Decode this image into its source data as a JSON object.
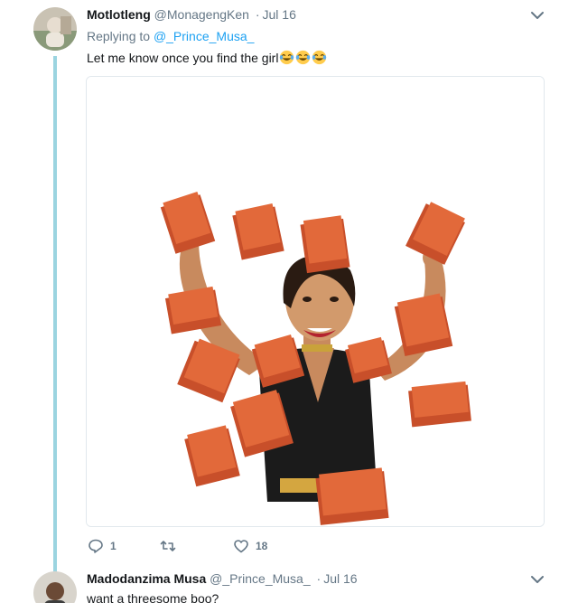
{
  "tweets": [
    {
      "display_name": "Motlotleng",
      "handle": "@MonagengKen",
      "separator": "·",
      "date": "Jul 16",
      "replying_label": "Replying to",
      "replying_to": "@_Prince_Musa_",
      "text": "Let me know once you find the girl",
      "emoji": [
        "face-with-tears-of-joy",
        "face-with-tears-of-joy",
        "face-with-tears-of-joy"
      ],
      "actions": {
        "reply_count": "1",
        "retweet_count": "",
        "like_count": "18"
      }
    },
    {
      "display_name": "Madodanzima Musa",
      "handle": "@_Prince_Musa_",
      "separator": "·",
      "date": "Jul 16",
      "text": "want a threesome boo?"
    }
  ],
  "icons": {
    "reply": "reply-icon",
    "retweet": "retweet-icon",
    "like": "heart-icon",
    "menu": "chevron-down-icon"
  },
  "colors": {
    "link": "#1da1f2",
    "muted": "#657786",
    "thread_line": "#9bd4e0",
    "brick": "#e2693a"
  }
}
